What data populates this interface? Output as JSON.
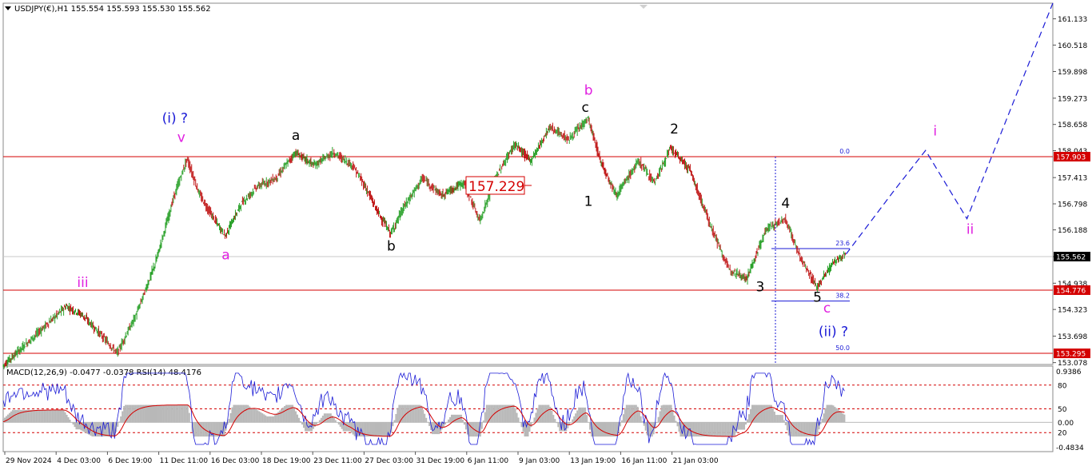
{
  "chart_data": {
    "type": "line",
    "symbol": "USDJPY(€),H1",
    "ohlc": [
      "155.554",
      "155.593",
      "155.530",
      "155.562"
    ],
    "indicator_label": "MACD(12,26,9) -0.0477 -0.0378 RSI(14) 48.4176",
    "price_axis_ticks": [
      "161.133",
      "160.518",
      "159.898",
      "159.273",
      "158.658",
      "158.043",
      "157.413",
      "156.798",
      "156.188",
      "155.562",
      "154.938",
      "154.323",
      "153.698",
      "153.078"
    ],
    "ylim": [
      153.0,
      161.5
    ],
    "current_price": "155.562",
    "horizontal_levels": [
      {
        "label": "157.903",
        "value": 157.903,
        "color": "#d40000"
      },
      {
        "label": "154.776",
        "value": 154.776,
        "color": "#d40000"
      },
      {
        "label": "153.295",
        "value": 153.295,
        "color": "#d40000"
      }
    ],
    "price_box_label": "157.229",
    "fib_levels": [
      {
        "label": "0.0",
        "value": 157.903
      },
      {
        "label": "23.6",
        "value": 155.75
      },
      {
        "label": "38.2",
        "value": 154.52
      },
      {
        "label": "50.0",
        "value": 153.295
      }
    ],
    "x_ticks": [
      "29 Nov 2024",
      "4 Dec 03:00",
      "6 Dec 19:00",
      "11 Dec 11:00",
      "16 Dec 03:00",
      "18 Dec 19:00",
      "23 Dec 11:00",
      "27 Dec 03:00",
      "31 Dec 19:00",
      "6 Jan 11:00",
      "9 Jan 03:00",
      "13 Jan 19:00",
      "16 Jan 11:00",
      "21 Jan 03:00"
    ],
    "price_path": [
      [
        0,
        153.0
      ],
      [
        10,
        153.7
      ],
      [
        20,
        154.4
      ],
      [
        25,
        154.2
      ],
      [
        30,
        153.8
      ],
      [
        36,
        153.3
      ],
      [
        42,
        154.2
      ],
      [
        48,
        155.4
      ],
      [
        54,
        157.0
      ],
      [
        58,
        157.85
      ],
      [
        62,
        157.0
      ],
      [
        66,
        156.5
      ],
      [
        70,
        156.05
      ],
      [
        75,
        156.8
      ],
      [
        80,
        157.2
      ],
      [
        86,
        157.4
      ],
      [
        92,
        158.0
      ],
      [
        98,
        157.7
      ],
      [
        104,
        158.0
      ],
      [
        110,
        157.7
      ],
      [
        114,
        157.2
      ],
      [
        118,
        156.6
      ],
      [
        122,
        156.1
      ],
      [
        126,
        156.7
      ],
      [
        132,
        157.4
      ],
      [
        138,
        157.0
      ],
      [
        145,
        157.3
      ],
      [
        150,
        156.4
      ],
      [
        155,
        157.4
      ],
      [
        161,
        158.2
      ],
      [
        166,
        157.8
      ],
      [
        172,
        158.6
      ],
      [
        178,
        158.3
      ],
      [
        184,
        158.8
      ],
      [
        188,
        157.8
      ],
      [
        193,
        157.0
      ],
      [
        200,
        157.8
      ],
      [
        205,
        157.3
      ],
      [
        210,
        158.1
      ],
      [
        216,
        157.6
      ],
      [
        222,
        156.4
      ],
      [
        228,
        155.3
      ],
      [
        234,
        155.05
      ],
      [
        240,
        156.2
      ],
      [
        246,
        156.45
      ],
      [
        251,
        155.5
      ],
      [
        256,
        154.85
      ],
      [
        261,
        155.4
      ],
      [
        265,
        155.6
      ]
    ],
    "projection_path": [
      [
        265,
        155.62
      ],
      [
        280,
        157.1
      ],
      [
        290,
        158.05
      ],
      [
        303,
        156.45
      ],
      [
        330,
        161.5
      ]
    ],
    "wave_labels": [
      {
        "text": "(i) ?",
        "x": 54,
        "y": 158.7,
        "color": "#1a1ad6"
      },
      {
        "text": "v",
        "x": 56,
        "y": 158.25,
        "color": "#e020e0"
      },
      {
        "text": "a",
        "x": 92,
        "y": 158.3,
        "color": "#000000"
      },
      {
        "text": "a",
        "x": 70,
        "y": 155.5,
        "color": "#e020e0"
      },
      {
        "text": "iii",
        "x": 25,
        "y": 154.85,
        "color": "#e020e0"
      },
      {
        "text": "b",
        "x": 122,
        "y": 155.7,
        "color": "#000000"
      },
      {
        "text": "b",
        "x": 184,
        "y": 159.35,
        "color": "#e020e0"
      },
      {
        "text": "c",
        "x": 183,
        "y": 158.95,
        "color": "#000000"
      },
      {
        "text": "1",
        "x": 184,
        "y": 156.75,
        "color": "#000000"
      },
      {
        "text": "2",
        "x": 211,
        "y": 158.45,
        "color": "#000000"
      },
      {
        "text": "3",
        "x": 238,
        "y": 154.75,
        "color": "#000000"
      },
      {
        "text": "4",
        "x": 246,
        "y": 156.7,
        "color": "#000000"
      },
      {
        "text": "5",
        "x": 256,
        "y": 154.5,
        "color": "#000000"
      },
      {
        "text": "c",
        "x": 259,
        "y": 154.25,
        "color": "#e020e0"
      },
      {
        "text": "(ii) ?",
        "x": 261,
        "y": 153.7,
        "color": "#1a1ad6"
      },
      {
        "text": "i",
        "x": 293,
        "y": 158.4,
        "color": "#e020e0"
      },
      {
        "text": "ii",
        "x": 304,
        "y": 156.1,
        "color": "#e020e0"
      }
    ],
    "macd_axis_ticks": [
      "0.9386",
      "-0.4834"
    ],
    "rsi_axis_ticks": [
      "80",
      "50",
      "0.00",
      "20"
    ]
  }
}
